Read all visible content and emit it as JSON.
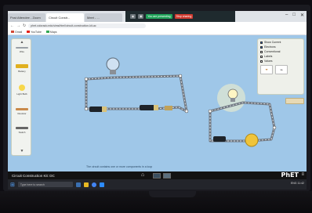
{
  "browser": {
    "tabs": [
      {
        "label": "Post Attendee - Zoom"
      },
      {
        "label": "Circuit Constr..."
      },
      {
        "label": "Meet - ..."
      }
    ],
    "url": "phet.colorado.edu/sims/html/circuit-construction-kit-ac",
    "bookmarks": [
      {
        "label": "Gmail",
        "color": "#d34836"
      },
      {
        "label": "YouTube",
        "color": "#e62117"
      },
      {
        "label": "Maps",
        "color": "#34a853"
      }
    ],
    "meet": {
      "present_label": "You are presenting",
      "stop_label": "Stop sharing"
    }
  },
  "toolbox": {
    "items": [
      {
        "label": "Wire",
        "color": "#9aa0a6"
      },
      {
        "label": "Battery",
        "color": "#e0b020"
      },
      {
        "label": "Light Bulb",
        "color": "#f7d74a"
      },
      {
        "label": "Resistor",
        "color": "#c98a4b"
      },
      {
        "label": "Switch",
        "color": "#666666"
      }
    ]
  },
  "controls": {
    "options": [
      {
        "label": "Show Current",
        "checked": true
      },
      {
        "label": "Electrons",
        "checked": true
      },
      {
        "label": "Conventional",
        "checked": false
      },
      {
        "label": "Labels",
        "checked": false
      },
      {
        "label": "Values",
        "checked": false
      }
    ]
  },
  "canvas": {
    "status_message": "The circuit contains one or more components in a loop"
  },
  "navbar": {
    "sim_title": "Circuit Construction Kit: DC",
    "brand": "PhET"
  },
  "taskbar": {
    "search_placeholder": "Type here to search",
    "tray_text": "ENG 11:42"
  }
}
